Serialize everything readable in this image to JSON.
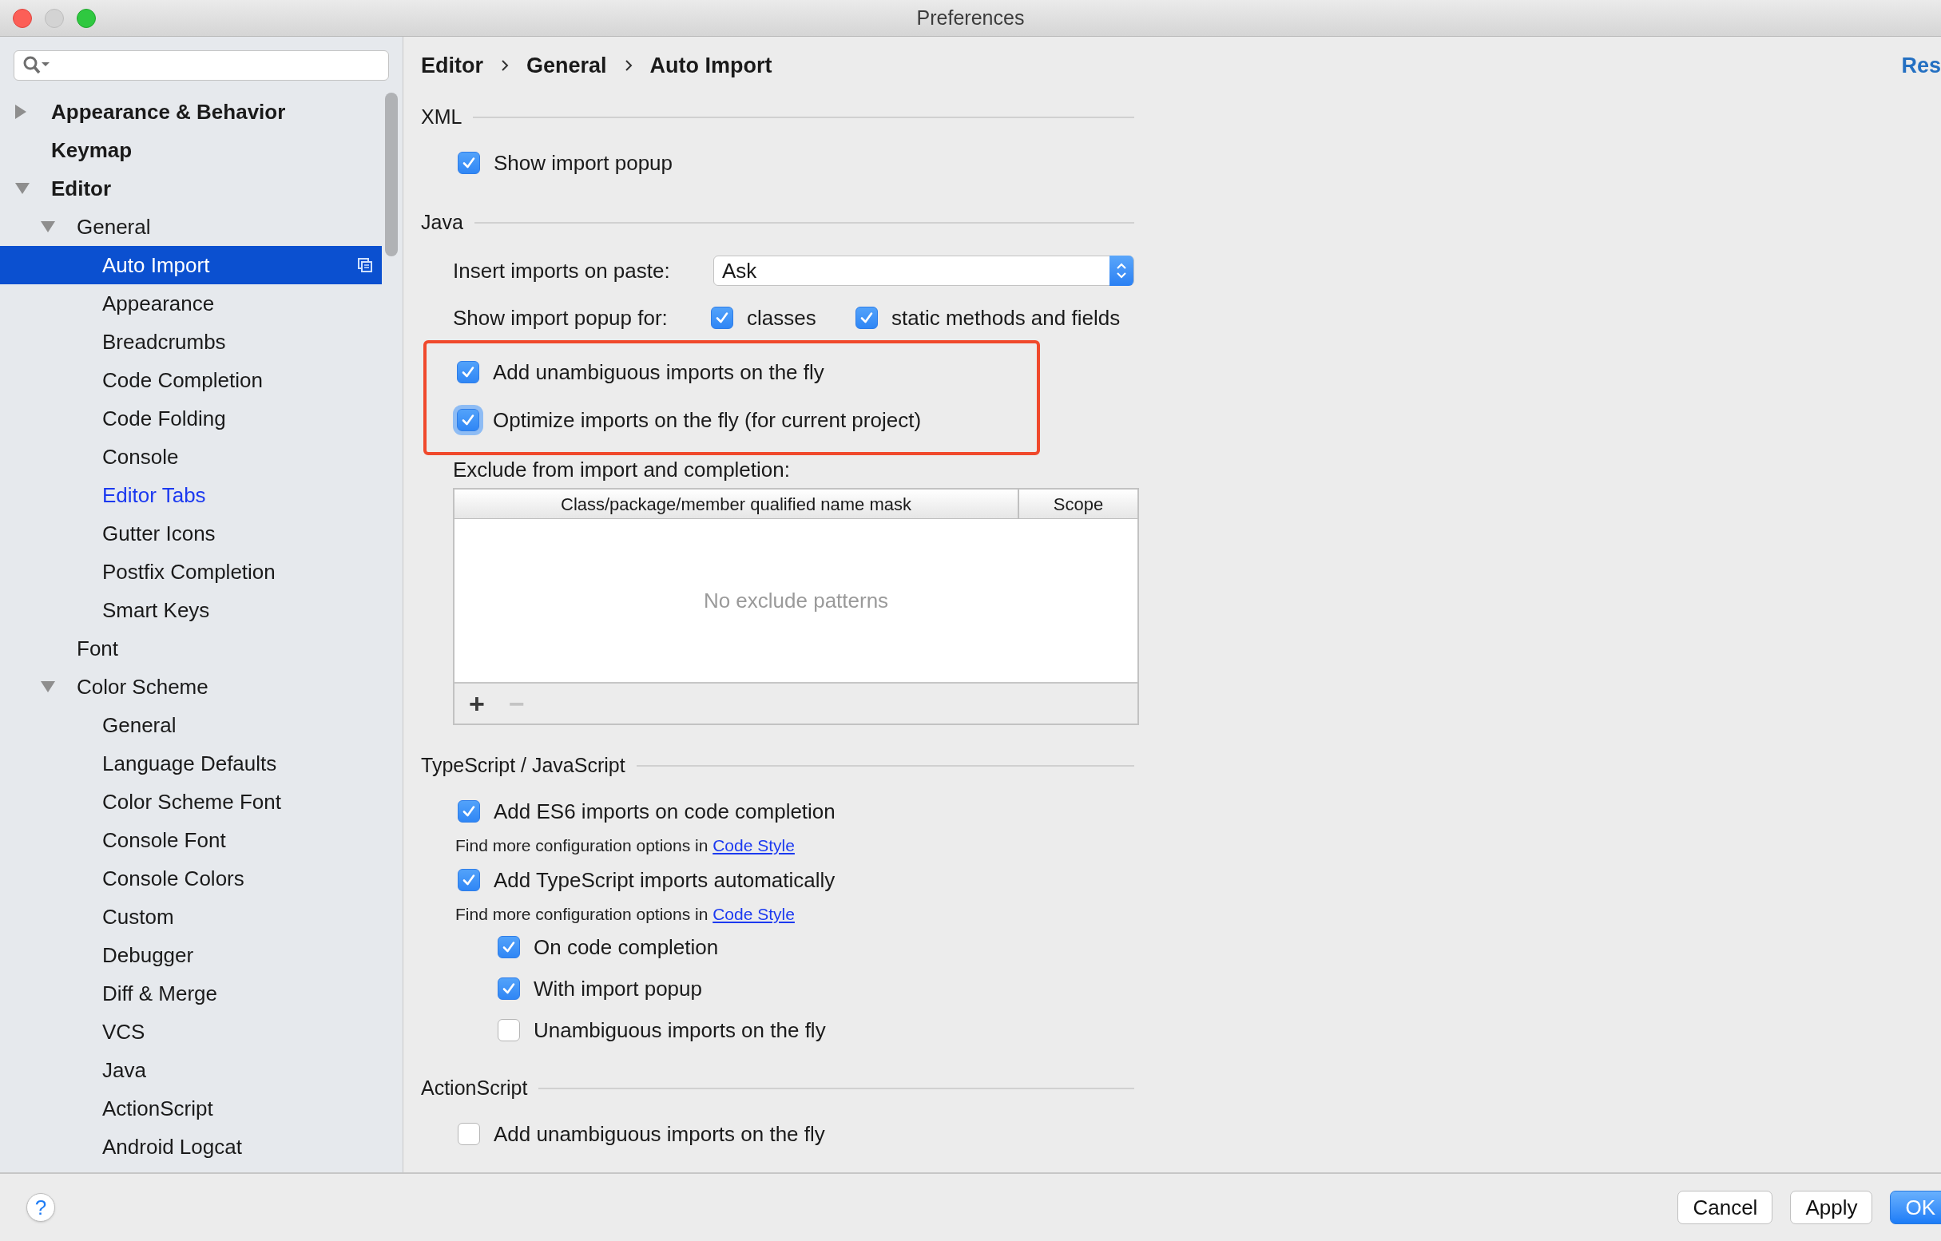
{
  "window": {
    "title": "Preferences"
  },
  "sidebar": {
    "items": [
      {
        "label": "Appearance & Behavior",
        "expanded": false,
        "selected": false,
        "modified": false
      },
      {
        "label": "Keymap",
        "selected": false,
        "modified": false
      },
      {
        "label": "Editor",
        "expanded": true,
        "selected": false,
        "modified": false,
        "children": [
          {
            "label": "General",
            "expanded": true,
            "selected": false,
            "modified": false,
            "children": [
              {
                "label": "Auto Import",
                "selected": true,
                "modified": false
              },
              {
                "label": "Appearance",
                "selected": false,
                "modified": false
              },
              {
                "label": "Breadcrumbs",
                "selected": false,
                "modified": false
              },
              {
                "label": "Code Completion",
                "selected": false,
                "modified": false
              },
              {
                "label": "Code Folding",
                "selected": false,
                "modified": false
              },
              {
                "label": "Console",
                "selected": false,
                "modified": false
              },
              {
                "label": "Editor Tabs",
                "selected": false,
                "modified": true
              },
              {
                "label": "Gutter Icons",
                "selected": false,
                "modified": false
              },
              {
                "label": "Postfix Completion",
                "selected": false,
                "modified": false
              },
              {
                "label": "Smart Keys",
                "selected": false,
                "modified": false
              }
            ]
          },
          {
            "label": "Font",
            "selected": false,
            "modified": false
          },
          {
            "label": "Color Scheme",
            "expanded": true,
            "selected": false,
            "modified": false,
            "children": [
              {
                "label": "General",
                "selected": false,
                "modified": false
              },
              {
                "label": "Language Defaults",
                "selected": false,
                "modified": false
              },
              {
                "label": "Color Scheme Font",
                "selected": false,
                "modified": false
              },
              {
                "label": "Console Font",
                "selected": false,
                "modified": false
              },
              {
                "label": "Console Colors",
                "selected": false,
                "modified": false
              },
              {
                "label": "Custom",
                "selected": false,
                "modified": false
              },
              {
                "label": "Debugger",
                "selected": false,
                "modified": false
              },
              {
                "label": "Diff & Merge",
                "selected": false,
                "modified": false
              },
              {
                "label": "VCS",
                "selected": false,
                "modified": false
              },
              {
                "label": "Java",
                "selected": false,
                "modified": false
              },
              {
                "label": "ActionScript",
                "selected": false,
                "modified": false
              },
              {
                "label": "Android Logcat",
                "selected": false,
                "modified": false
              }
            ]
          }
        ]
      }
    ]
  },
  "breadcrumb": [
    "Editor",
    "General",
    "Auto Import"
  ],
  "reset_link": "Res",
  "sections": [
    {
      "title": "XML",
      "rows": [
        {
          "kind": "checkbox",
          "label": "Show import popup",
          "checked": true
        }
      ]
    },
    {
      "title": "Java",
      "rows": [
        {
          "kind": "dropdown",
          "label": "Insert imports on paste:",
          "value": "Ask"
        },
        {
          "kind": "options",
          "label": "Show import popup for:",
          "options": [
            {
              "label": "classes",
              "checked": true
            },
            {
              "label": "static methods and fields",
              "checked": true
            }
          ]
        },
        {
          "kind": "group",
          "outlined": true,
          "rows": [
            {
              "kind": "checkbox",
              "label": "Add unambiguous imports on the fly",
              "checked": true
            },
            {
              "kind": "checkbox",
              "label": "Optimize imports on the fly (for current project)",
              "checked": true,
              "focused": true
            }
          ]
        },
        {
          "kind": "table",
          "label": "Exclude from import and completion:",
          "columns": [
            "Class/package/member qualified name mask",
            "Scope"
          ],
          "empty_text": "No exclude patterns",
          "toolbar": [
            {
              "symbol": "+",
              "disabled": false
            },
            {
              "symbol": "−",
              "disabled": true
            }
          ]
        }
      ]
    },
    {
      "title": "TypeScript / JavaScript",
      "rows": [
        {
          "kind": "checkbox",
          "label": "Add ES6 imports on code completion",
          "checked": true,
          "hint": {
            "text": "Find more configuration options in",
            "link": "Code Style"
          }
        },
        {
          "kind": "checkbox",
          "label": "Add TypeScript imports automatically",
          "checked": true,
          "hint": {
            "text": "Find more configuration options in",
            "link": "Code Style"
          },
          "children": [
            {
              "kind": "checkbox",
              "label": "On code completion",
              "checked": true
            },
            {
              "kind": "checkbox",
              "label": "With import popup",
              "checked": true
            },
            {
              "kind": "checkbox",
              "label": "Unambiguous imports on the fly",
              "checked": false
            }
          ]
        }
      ]
    },
    {
      "title": "ActionScript",
      "rows": [
        {
          "kind": "checkbox",
          "label": "Add unambiguous imports on the fly",
          "checked": false
        }
      ]
    }
  ],
  "help_button": "?",
  "buttons": [
    {
      "label": "Cancel",
      "primary": false
    },
    {
      "label": "Apply",
      "primary": false
    },
    {
      "label": "OK",
      "primary": true
    }
  ]
}
